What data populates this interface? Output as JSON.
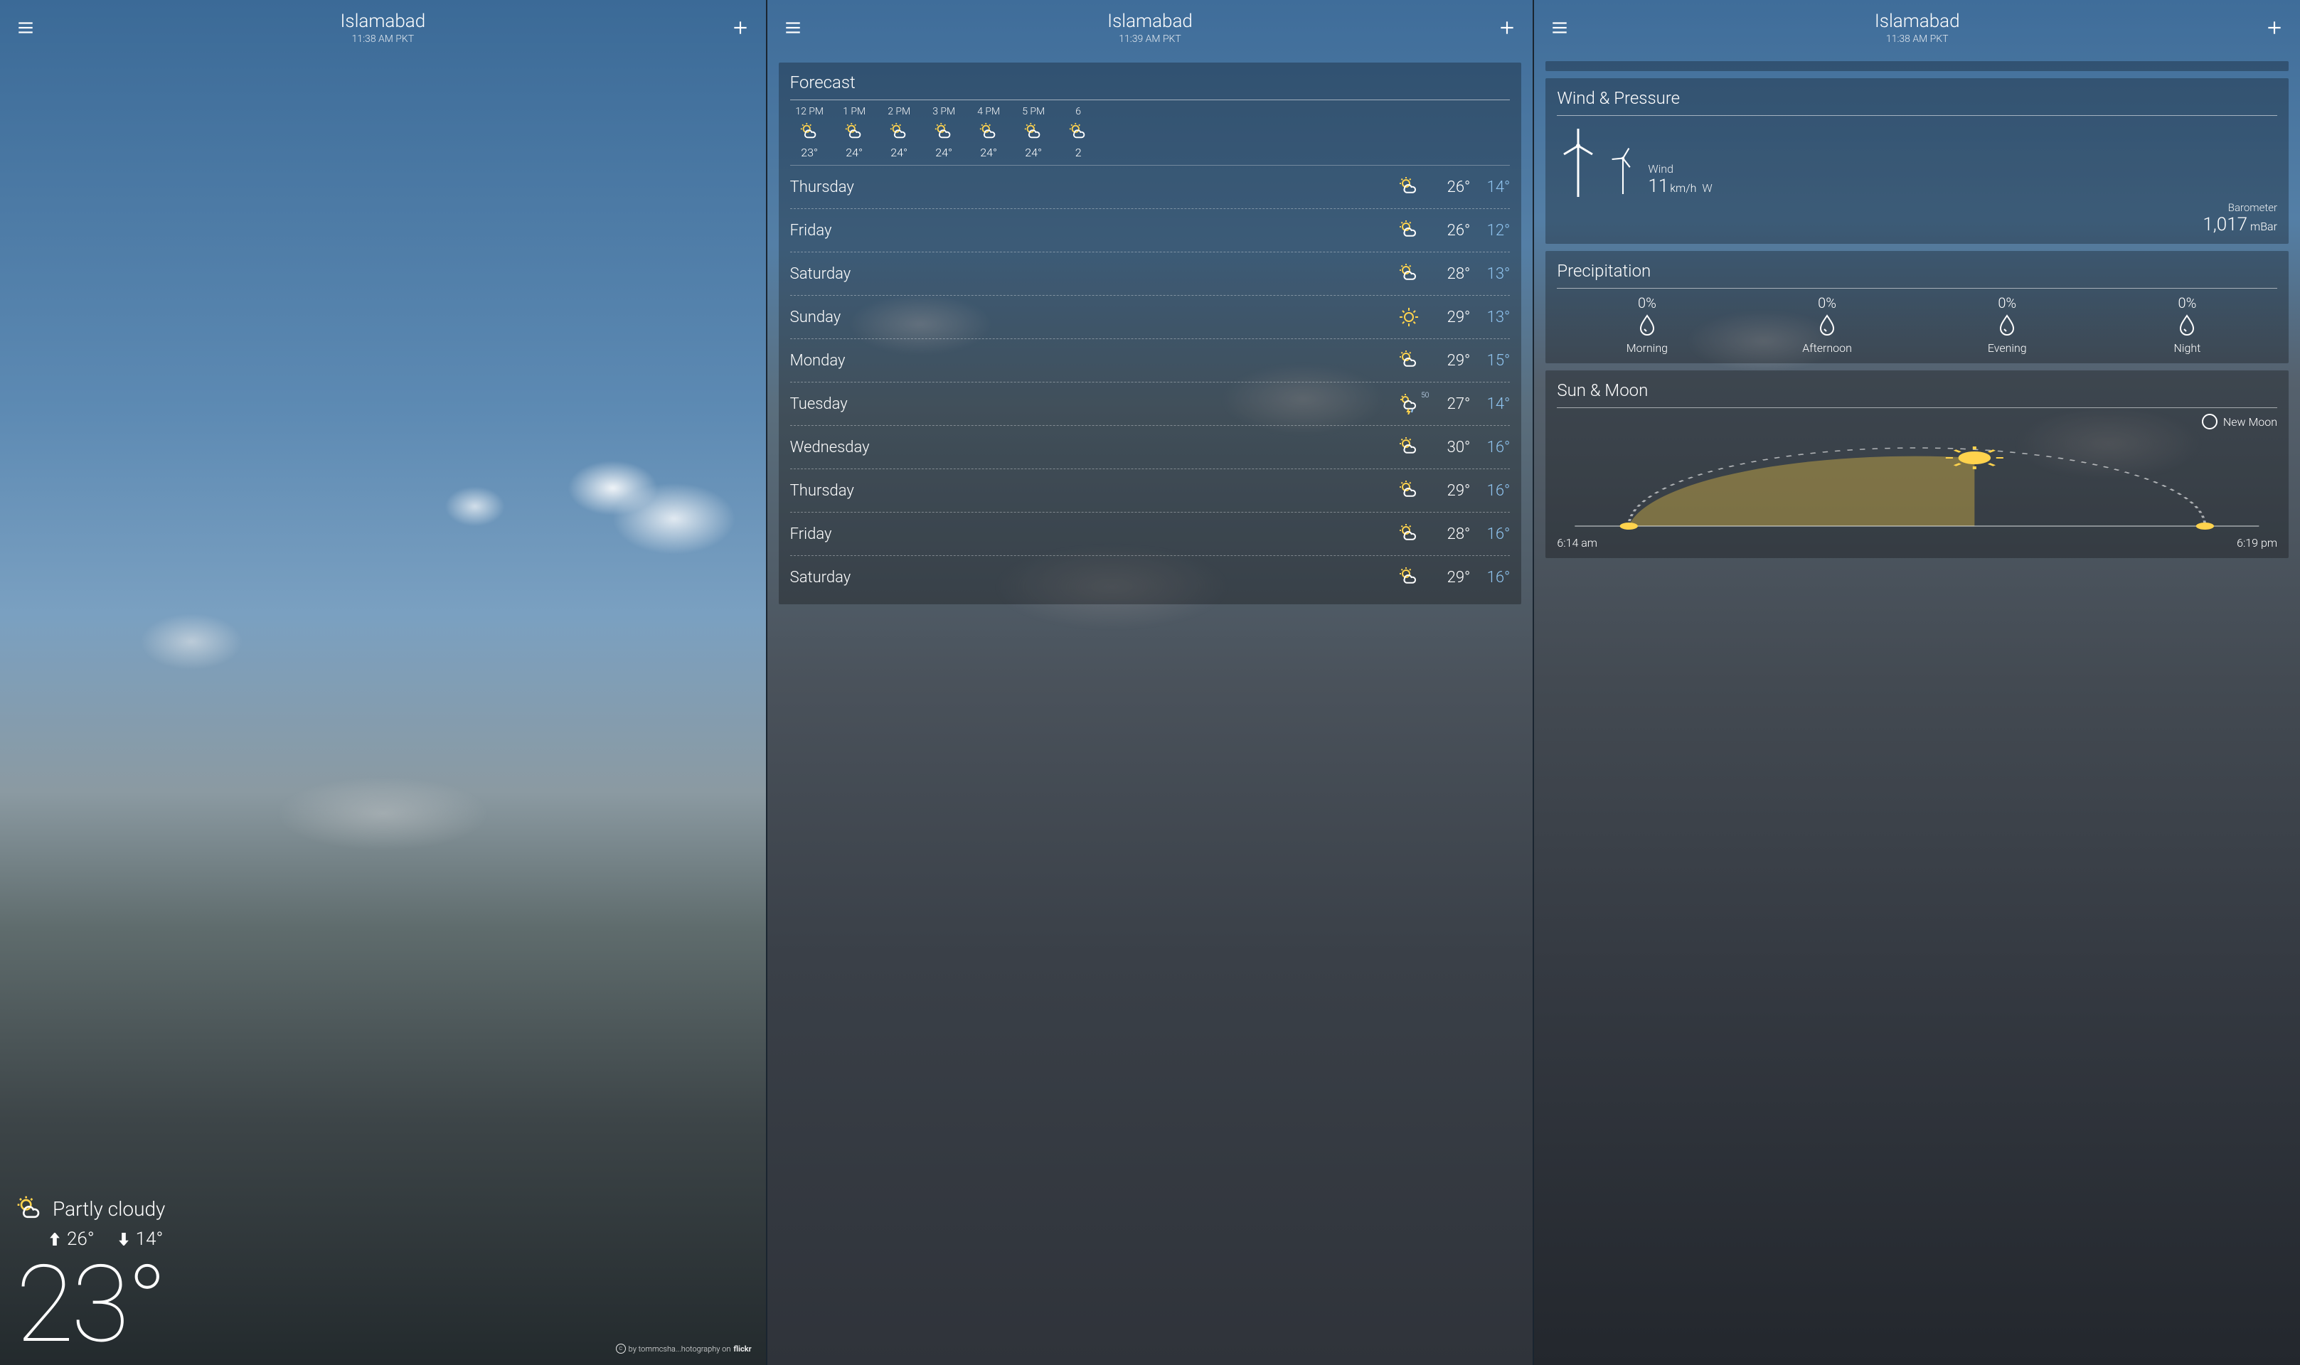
{
  "location": "Islamabad",
  "screens": {
    "s1": {
      "timestamp": "11:38 AM PKT"
    },
    "s2": {
      "timestamp": "11:39 AM PKT"
    },
    "s3": {
      "timestamp": "11:38 AM PKT"
    }
  },
  "current": {
    "condition": "Partly cloudy",
    "high": "26°",
    "low": "14°",
    "temp": "23°"
  },
  "attribution": {
    "prefix": "by tommcsha...hotography on",
    "service": "flickr"
  },
  "forecast": {
    "title": "Forecast",
    "hourly": [
      {
        "time": "12 PM",
        "icon": "partly-cloudy",
        "temp": "23°"
      },
      {
        "time": "1 PM",
        "icon": "partly-cloudy",
        "temp": "24°"
      },
      {
        "time": "2 PM",
        "icon": "partly-cloudy",
        "temp": "24°"
      },
      {
        "time": "3 PM",
        "icon": "partly-cloudy",
        "temp": "24°"
      },
      {
        "time": "4 PM",
        "icon": "partly-cloudy",
        "temp": "24°"
      },
      {
        "time": "5 PM",
        "icon": "partly-cloudy",
        "temp": "24°"
      },
      {
        "time": "6",
        "icon": "partly-cloudy",
        "temp": "2"
      }
    ],
    "daily": [
      {
        "name": "Thursday",
        "icon": "partly-cloudy",
        "high": "26°",
        "low": "14°"
      },
      {
        "name": "Friday",
        "icon": "partly-cloudy",
        "high": "26°",
        "low": "12°"
      },
      {
        "name": "Saturday",
        "icon": "partly-cloudy",
        "high": "28°",
        "low": "13°"
      },
      {
        "name": "Sunday",
        "icon": "sunny",
        "high": "29°",
        "low": "13°"
      },
      {
        "name": "Monday",
        "icon": "partly-cloudy",
        "high": "29°",
        "low": "15°"
      },
      {
        "name": "Tuesday",
        "icon": "storm",
        "high": "27°",
        "low": "14°",
        "pop": "50"
      },
      {
        "name": "Wednesday",
        "icon": "partly-cloudy",
        "high": "30°",
        "low": "16°"
      },
      {
        "name": "Thursday",
        "icon": "partly-cloudy",
        "high": "29°",
        "low": "16°"
      },
      {
        "name": "Friday",
        "icon": "partly-cloudy",
        "high": "28°",
        "low": "16°"
      },
      {
        "name": "Saturday",
        "icon": "partly-cloudy",
        "high": "29°",
        "low": "16°"
      }
    ]
  },
  "wind": {
    "title": "Wind & Pressure",
    "wind_label": "Wind",
    "speed": "11",
    "unit": "km/h",
    "direction": "W",
    "barometer_label": "Barometer",
    "pressure": "1,017",
    "pressure_unit": "mBar"
  },
  "precip": {
    "title": "Precipitation",
    "periods": [
      {
        "label": "Morning",
        "value": "0%"
      },
      {
        "label": "Afternoon",
        "value": "0%"
      },
      {
        "label": "Evening",
        "value": "0%"
      },
      {
        "label": "Night",
        "value": "0%"
      }
    ]
  },
  "sunmoon": {
    "title": "Sun & Moon",
    "moon_phase": "New Moon",
    "sunrise": "6:14 am",
    "sunset": "6:19 pm"
  }
}
